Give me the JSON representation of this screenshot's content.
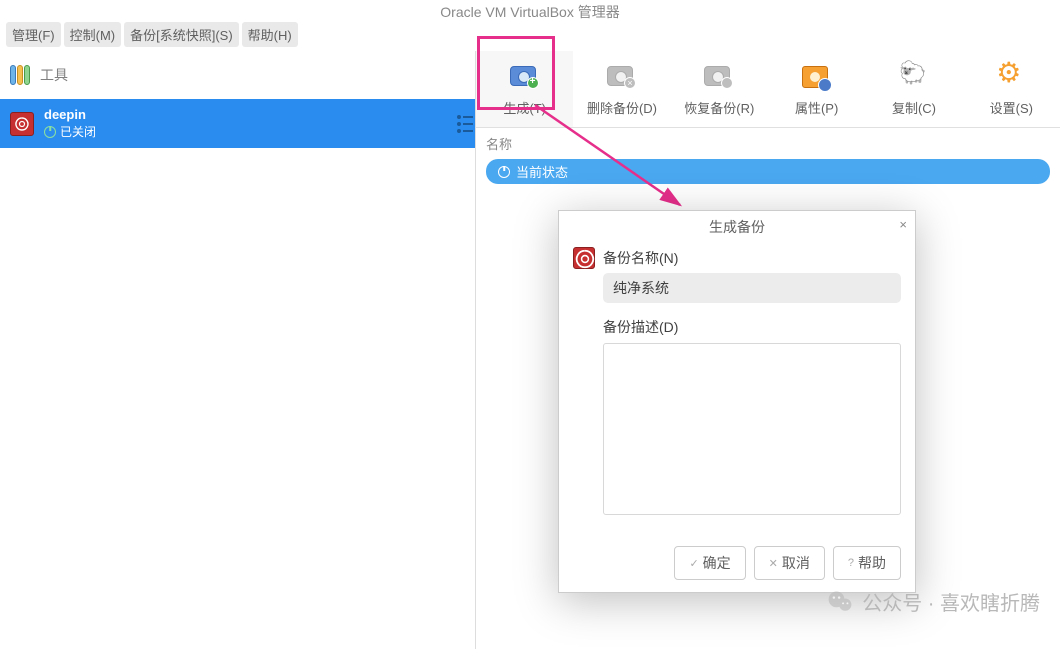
{
  "window_title": "Oracle VM VirtualBox 管理器",
  "menu": {
    "manage": "管理(F)",
    "control": "控制(M)",
    "backup": "备份[系统快照](S)",
    "help": "帮助(H)"
  },
  "left": {
    "tools_label": "工具",
    "vm": {
      "name": "deepin",
      "status": "已关闭"
    }
  },
  "toolbar": {
    "create": "生成(T)",
    "delete": "删除备份(D)",
    "restore": "恢复备份(R)",
    "properties": "属性(P)",
    "clone": "复制(C)",
    "settings": "设置(S)"
  },
  "snapshot": {
    "header": "名称",
    "current": "当前状态"
  },
  "dialog": {
    "title": "生成备份",
    "name_label": "备份名称(N)",
    "name_value": "纯净系统",
    "desc_label": "备份描述(D)",
    "desc_value": "",
    "ok": "确定",
    "cancel": "取消",
    "help": "帮助"
  },
  "watermark": "公众号 · 喜欢瞎折腾"
}
